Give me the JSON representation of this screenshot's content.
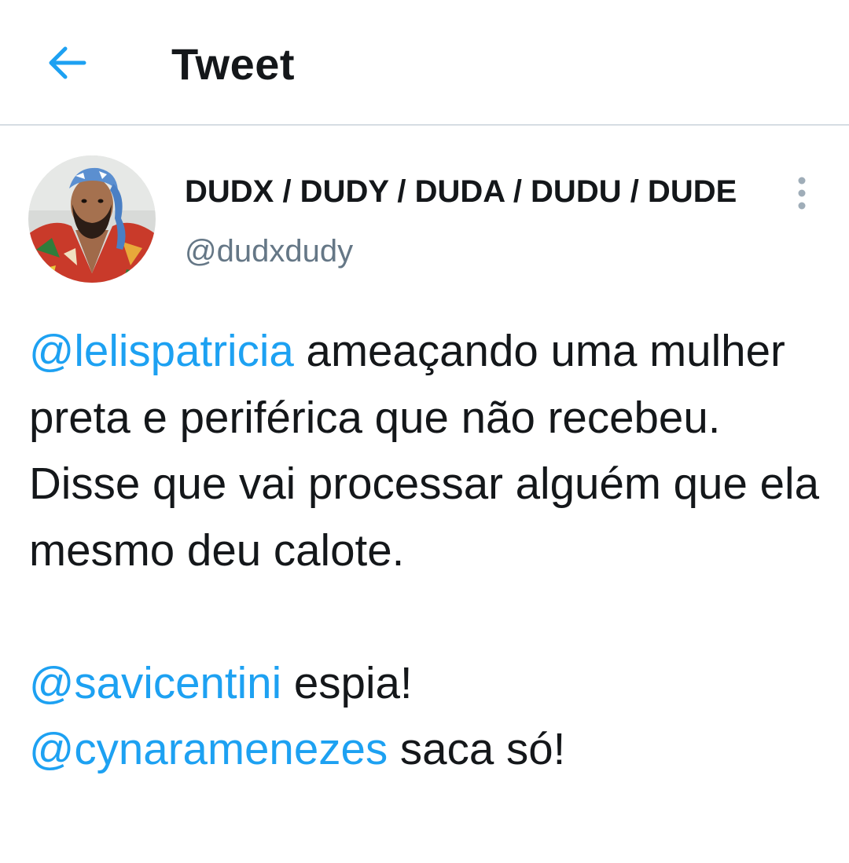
{
  "header": {
    "title": "Tweet",
    "back_icon": "arrow-left-icon"
  },
  "author": {
    "display_name": "DUDX / DUDY / DUDA / DUDU / DUDE",
    "handle": "@dudxdudy",
    "avatar_icon": "user-avatar-photo"
  },
  "more_icon": "vertical-ellipsis-icon",
  "tweet": {
    "para1_mention": "@lelispatricia",
    "para1_text": " ameaçando uma mulher preta e periférica que não recebeu. Disse que vai processar alguém que ela mesmo deu calote.",
    "line2_mention": "@savicentini",
    "line2_text": " espia!",
    "line3_mention": "@cynaramenezes",
    "line3_text": " saca só!"
  },
  "colors": {
    "accent": "#1da1f2",
    "text": "#14171a",
    "secondary": "#657786",
    "divider": "#d6dde3"
  }
}
